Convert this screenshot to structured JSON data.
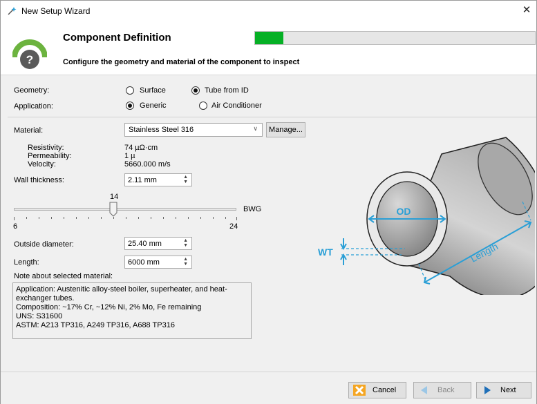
{
  "window": {
    "title": "New Setup Wizard",
    "close_glyph": "✕"
  },
  "header": {
    "title": "Component Definition",
    "subtitle": "Configure the geometry and material of the component to inspect",
    "progress_fraction": 0.1,
    "progress_color": "#06b025"
  },
  "geometry": {
    "label": "Geometry:",
    "options": [
      "Surface",
      "Tube from ID"
    ],
    "selected": "Tube from ID"
  },
  "application": {
    "label": "Application:",
    "options": [
      "Generic",
      "Air Conditioner"
    ],
    "selected": "Generic"
  },
  "material": {
    "label": "Material:",
    "value": "Stainless Steel 316",
    "manage_label": "Manage...",
    "props": [
      {
        "name": "Resistivity:",
        "value": "74 µΩ·cm"
      },
      {
        "name": "Permeability:",
        "value": "1 µ"
      },
      {
        "name": "Velocity:",
        "value": "5660.000 m/s"
      }
    ]
  },
  "wall_thickness": {
    "label": "Wall thickness:",
    "value": "2.11 mm",
    "slider_value": "14",
    "slider_min": "6",
    "slider_max": "24",
    "slider_unit": "BWG"
  },
  "outside_diameter": {
    "label": "Outside diameter:",
    "value": "25.40 mm"
  },
  "length": {
    "label": "Length:",
    "value": "6000 mm"
  },
  "note": {
    "label": "Note about selected material:",
    "lines": [
      "Application: Austenitic alloy-steel boiler, superheater, and heat-",
      "exchanger tubes.",
      "Composition: ~17% Cr, ~12% Ni, 2% Mo, Fe remaining",
      "UNS: S31600",
      "ASTM: A213 TP316, A249 TP316, A688 TP316"
    ]
  },
  "diagram": {
    "od_label": "OD",
    "wt_label": "WT",
    "length_label": "Length",
    "accent_color": "#2a9fd6"
  },
  "footer": {
    "cancel_label": "Cancel",
    "back_label": "Back",
    "next_label": "Next"
  }
}
